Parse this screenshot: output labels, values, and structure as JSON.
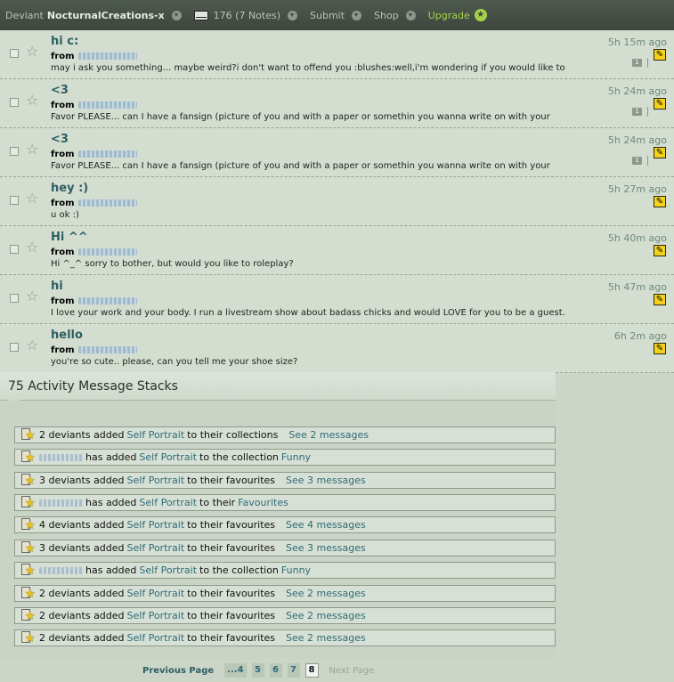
{
  "topbar": {
    "deviant_label": "Deviant",
    "username": "NocturnalCreations-x",
    "notes_count": "176 (7 Notes)",
    "submit": "Submit",
    "shop": "Shop",
    "upgrade": "Upgrade"
  },
  "notes": [
    {
      "subject": "hi c:",
      "from_label": "from",
      "time": "5h 15m ago",
      "preview": "may i ask you something... maybe weird?i don't want to offend you :blushes:well,i'm wondering if you would like to",
      "has_count": true,
      "count": "1"
    },
    {
      "subject": "<3",
      "from_label": "from",
      "time": "5h 24m ago",
      "preview": "Favor PLEASE... can I have a fansign (picture of you and with a paper or somethin you wanna write on with your",
      "has_count": true,
      "count": "1"
    },
    {
      "subject": "<3",
      "from_label": "from",
      "time": "5h 24m ago",
      "preview": "Favor PLEASE... can I have a fansign (picture of you and with a paper or somethin you wanna write on with your",
      "has_count": true,
      "count": "1"
    },
    {
      "subject": "hey :)",
      "from_label": "from",
      "time": "5h 27m ago",
      "preview": "u ok :)",
      "has_count": false
    },
    {
      "subject": "Hi ^^",
      "from_label": "from",
      "time": "5h 40m ago",
      "preview": "Hi ^_^ sorry to bother, but would you like to roleplay?",
      "has_count": false
    },
    {
      "subject": "hi",
      "from_label": "from",
      "time": "5h 47m ago",
      "preview": "I love your work and your body. I run a livestream show about badass chicks and would LOVE for you to be a guest.",
      "has_count": false
    },
    {
      "subject": "hello",
      "from_label": "from",
      "time": "6h 2m ago",
      "preview": "you're so cute.. please, can you tell me your shoe size?",
      "has_count": false
    }
  ],
  "activity": {
    "title": "75 Activity Message Stacks",
    "stacks": [
      {
        "pre": "2 deviants added",
        "link": "Self Portrait",
        "post": "to their collections",
        "target": "",
        "see": "See 2 messages"
      },
      {
        "pre": "has added",
        "blur": true,
        "link": "Self Portrait",
        "post": "to the collection",
        "target": "Funny",
        "see": ""
      },
      {
        "pre": "3 deviants added",
        "link": "Self Portrait",
        "post": "to their favourites",
        "target": "",
        "see": "See 3 messages"
      },
      {
        "pre": "has added",
        "blur": true,
        "link": "Self Portrait",
        "post": "to their",
        "target": "Favourites",
        "see": ""
      },
      {
        "pre": "4 deviants added",
        "link": "Self Portrait",
        "post": "to their favourites",
        "target": "",
        "see": "See 4 messages"
      },
      {
        "pre": "3 deviants added",
        "link": "Self Portrait",
        "post": "to their favourites",
        "target": "",
        "see": "See 3 messages"
      },
      {
        "pre": "has added",
        "blur": true,
        "link": "Self Portrait",
        "post": "to the collection",
        "target": "Funny",
        "see": ""
      },
      {
        "pre": "2 deviants added",
        "link": "Self Portrait",
        "post": "to their favourites",
        "target": "",
        "see": "See 2 messages"
      },
      {
        "pre": "2 deviants added",
        "link": "Self Portrait",
        "post": "to their favourites",
        "target": "",
        "see": "See 2 messages"
      },
      {
        "pre": "2 deviants added",
        "link": "Self Portrait",
        "post": "to their favourites",
        "target": "",
        "see": "See 2 messages"
      }
    ]
  },
  "pager": {
    "previous": "Previous Page",
    "pages": [
      "...4",
      "5",
      "6",
      "7",
      "8"
    ],
    "current": "8",
    "next": "Next Page"
  }
}
